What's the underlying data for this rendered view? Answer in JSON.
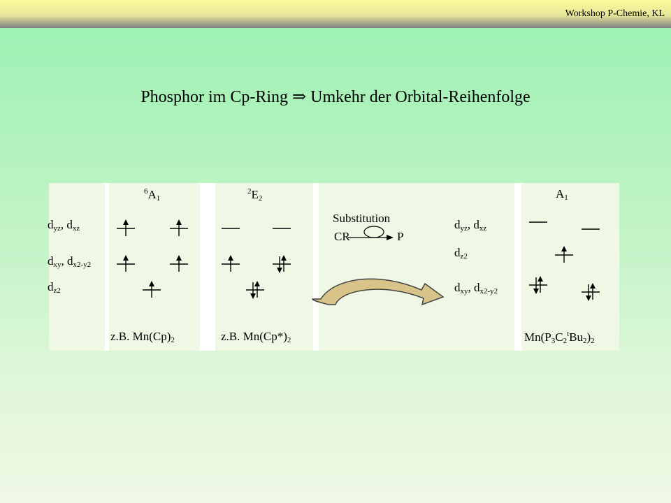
{
  "header": {
    "label": "Workshop P-Chemie, KL"
  },
  "title": "Phosphor im Cp-Ring  ⇒ Umkehr der Orbital-Reihenfolge",
  "diagram": {
    "left_orbitals": {
      "dyz": "d",
      "dyz_sub": "yz",
      "dxz": "d",
      "dxz_sub": "xz",
      "dxy": "d",
      "dxy_sub": "xy",
      "dx2y2": "d",
      "dx2y2_sub": "x2-y2",
      "dz2": "d",
      "dz2_sub": "z2"
    },
    "state_6a1": {
      "sup": "6",
      "main": "A",
      "sub": "1"
    },
    "state_2e2": {
      "sup": "2",
      "main": "E",
      "sub": "2"
    },
    "state_a1_right": {
      "main": "A",
      "sub": "1"
    },
    "substitution": {
      "label": "Substitution",
      "from": "CR",
      "to": "P"
    },
    "right_orbitals": {
      "dyz": "d",
      "dyz_sub": "yz",
      "dxz": "d",
      "dxz_sub": "xz",
      "dz2": "d",
      "dz2_sub": "z2",
      "dxy": "d",
      "dxy_sub": "xy",
      "dx2y2": "d",
      "dx2y2_sub": "x2-y2"
    },
    "examples": {
      "mncp": "z.B.  Mn(Cp)",
      "mncp_sub": "2",
      "mncpstar": "z.B.  Mn(Cp*)",
      "mncpstar_sub": "2",
      "mnp3": {
        "a": "Mn(P",
        "b": "3",
        "c": "C",
        "d": "2",
        "e": "t",
        "f": "Bu",
        "g": "2",
        "h": ")",
        "i": "2"
      }
    },
    "colors": {
      "arrow_fill": "#d8c488",
      "arrow_stroke": "#444444"
    }
  }
}
